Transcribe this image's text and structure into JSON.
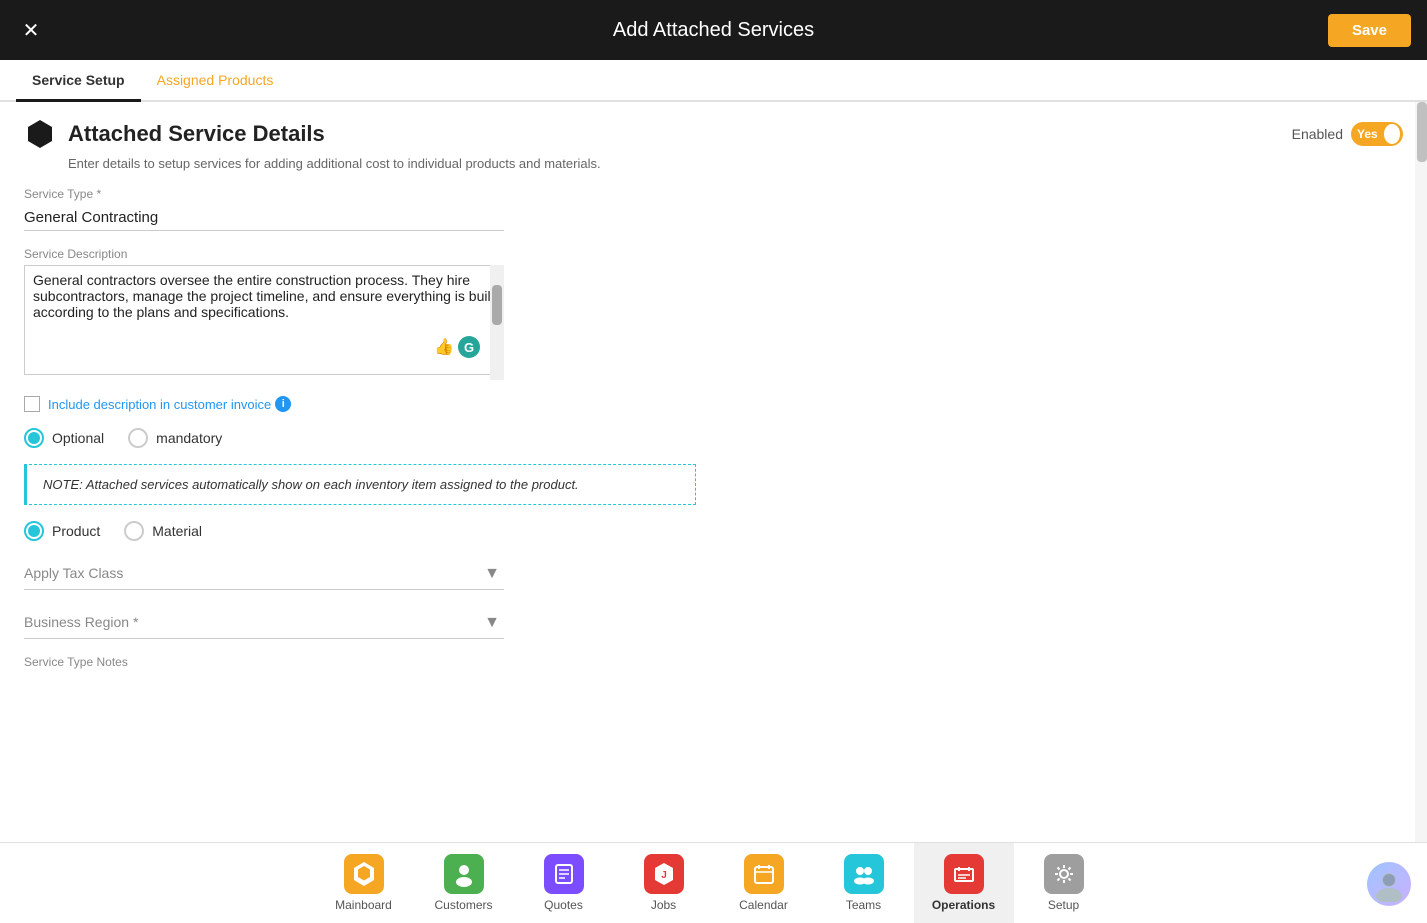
{
  "header": {
    "close_label": "✕",
    "title": "Add Attached Services",
    "save_label": "Save"
  },
  "tabs": [
    {
      "id": "service-setup",
      "label": "Service Setup",
      "active": true
    },
    {
      "id": "assigned-products",
      "label": "Assigned Products",
      "active": false
    }
  ],
  "section": {
    "title": "Attached Service Details",
    "subtitle": "Enter details to setup services for adding additional cost to individual products and materials.",
    "enabled_label": "Enabled",
    "toggle_value": "Yes"
  },
  "fields": {
    "service_type_label": "Service Type *",
    "service_type_value": "General Contracting",
    "service_description_label": "Service Description",
    "service_description_value": "General contractors oversee the entire construction process. They hire subcontractors, manage the project timeline, and ensure everything is built according to the plans and specifications.",
    "checkbox_label": "Include description in customer invoice",
    "radio_optional_label": "Optional",
    "radio_mandatory_label": "mandatory",
    "note_text": "NOTE: Attached services automatically show on each inventory item assigned to the product.",
    "radio_product_label": "Product",
    "radio_material_label": "Material",
    "apply_tax_class_label": "Apply Tax Class",
    "business_region_label": "Business Region *",
    "service_type_notes_label": "Service Type Notes"
  },
  "bottom_nav": [
    {
      "id": "mainboard",
      "label": "Mainboard",
      "icon": "🏠",
      "color": "#f5a623",
      "active": false
    },
    {
      "id": "customers",
      "label": "Customers",
      "icon": "👤",
      "color": "#4caf50",
      "active": false
    },
    {
      "id": "quotes",
      "label": "Quotes",
      "icon": "📋",
      "color": "#7c4dff",
      "active": false
    },
    {
      "id": "jobs",
      "label": "Jobs",
      "icon": "🔧",
      "color": "#e53935",
      "active": false
    },
    {
      "id": "calendar",
      "label": "Calendar",
      "icon": "📅",
      "color": "#f5a623",
      "active": false
    },
    {
      "id": "teams",
      "label": "Teams",
      "icon": "🔵",
      "color": "#26c6da",
      "active": false
    },
    {
      "id": "operations",
      "label": "Operations",
      "icon": "📦",
      "color": "#e53935",
      "active": true
    },
    {
      "id": "setup",
      "label": "Setup",
      "icon": "⚙️",
      "color": "#9e9e9e",
      "active": false
    }
  ]
}
